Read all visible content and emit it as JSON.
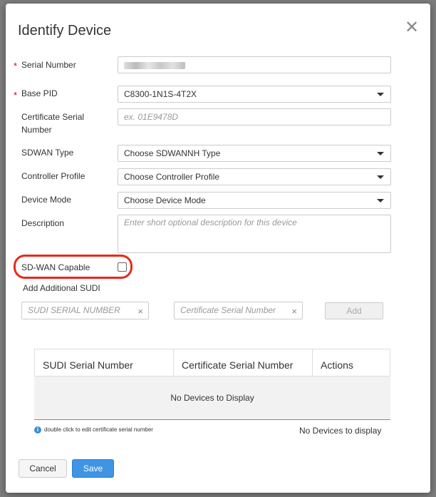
{
  "dialog": {
    "title": "Identify Device"
  },
  "fields": {
    "serial_number": {
      "label": "Serial Number",
      "value": ""
    },
    "base_pid": {
      "label": "Base PID",
      "value": "C8300-1N1S-4T2X"
    },
    "cert_serial": {
      "label_line1": "Certificate Serial",
      "label_line2": "Number",
      "placeholder": "ex. 01E9478D"
    },
    "sdwan_type": {
      "label": "SDWAN Type",
      "value": "Choose SDWANNH Type"
    },
    "controller_profile": {
      "label": "Controller Profile",
      "value": "Choose Controller Profile"
    },
    "device_mode": {
      "label": "Device Mode",
      "value": "Choose Device Mode"
    },
    "description": {
      "label": "Description",
      "placeholder": "Enter short optional description for this device"
    },
    "sdwan_capable": {
      "label": "SD-WAN Capable",
      "checked": false
    }
  },
  "sudi": {
    "heading": "Add Additional SUDI",
    "serial_placeholder": "SUDI SERIAL NUMBER",
    "cert_placeholder": "Certificate Serial Number",
    "add_label": "Add",
    "clear_glyph": "×"
  },
  "table": {
    "columns": [
      "SUDI Serial Number",
      "Certificate Serial Number",
      "Actions"
    ],
    "empty_text": "No Devices to Display"
  },
  "footer": {
    "hint": "double click to edit certificate serial number",
    "info_glyph": "i",
    "count_text": "No Devices to display",
    "cancel_label": "Cancel",
    "save_label": "Save",
    "close_glyph": "✕",
    "required_glyph": "*"
  },
  "colors": {
    "accent": "#3f95e4",
    "required": "#d0021b",
    "highlight": "#e8291c"
  }
}
